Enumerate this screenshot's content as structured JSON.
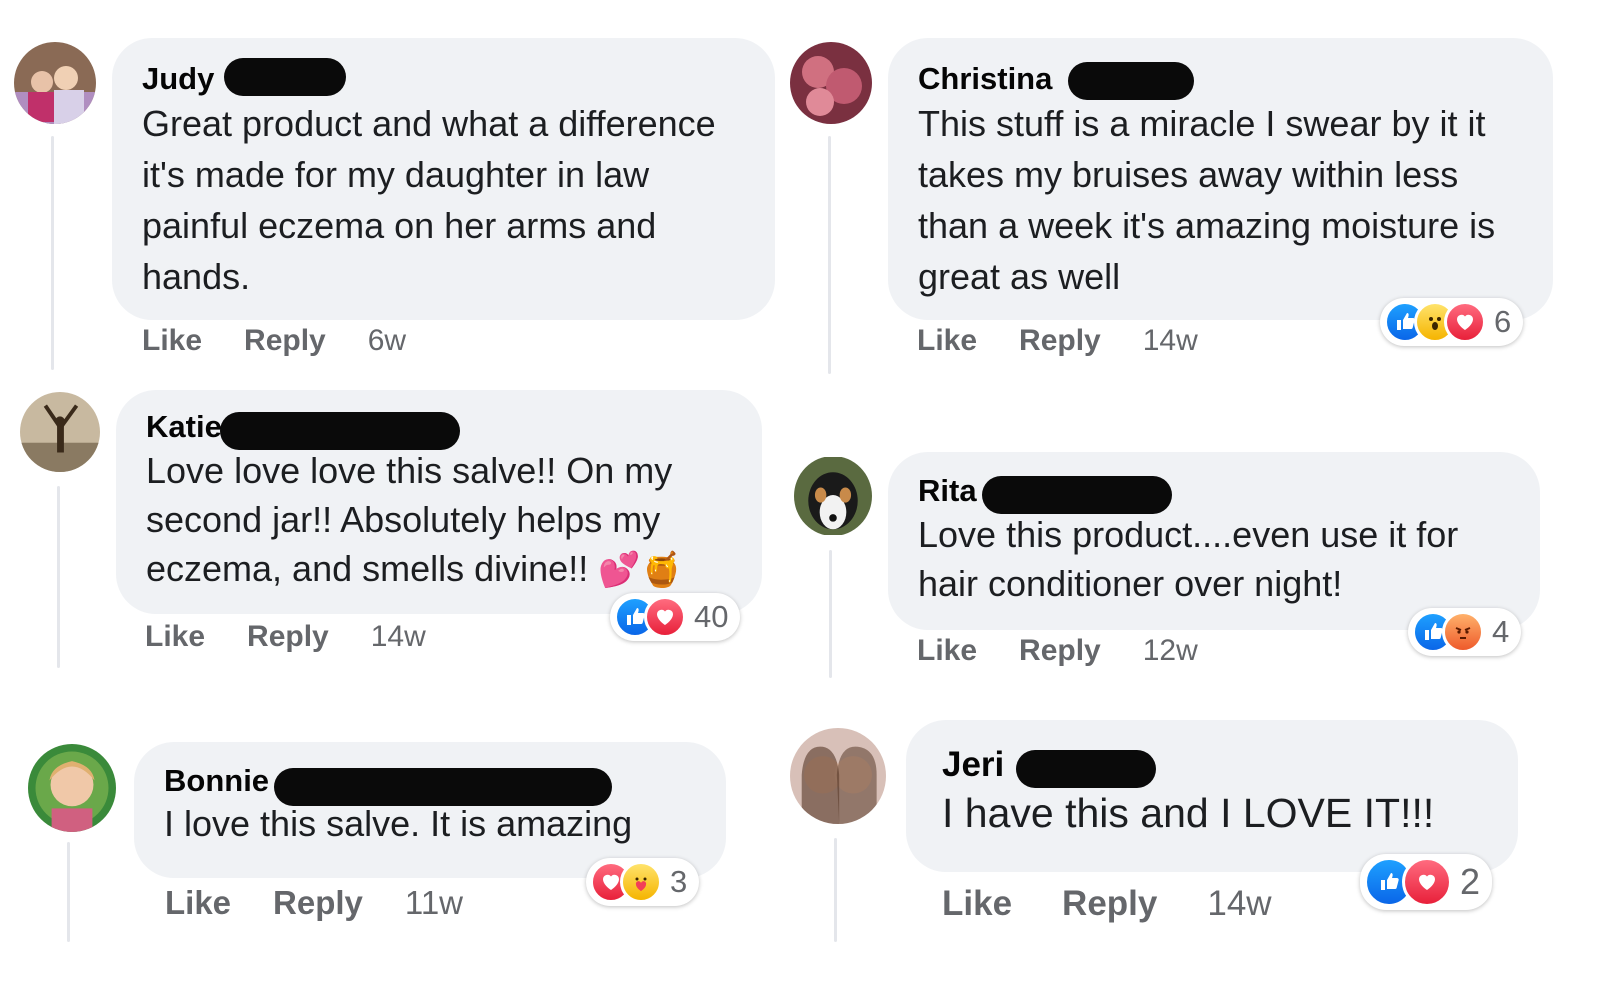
{
  "comments": [
    {
      "name": "Judy",
      "text": "Great product and what a difference it's made for my daughter in law painful eczema on her arms and hands.",
      "actions": {
        "like": "Like",
        "reply": "Reply",
        "time": "6w"
      },
      "reactions": null
    },
    {
      "name": "Christina",
      "text": "This stuff is a miracle I swear by it it takes my bruises away within less than a week it's amazing moisture is great as well",
      "actions": {
        "like": "Like",
        "reply": "Reply",
        "time": "14w"
      },
      "reactions": {
        "icons": [
          "like-icon",
          "wow-icon",
          "love-icon"
        ],
        "count": "6"
      }
    },
    {
      "name": "Katie",
      "text": "Love love love this salve!! On my second jar!! Absolutely helps my eczema, and smells divine!!",
      "emoji": "💕🍯",
      "actions": {
        "like": "Like",
        "reply": "Reply",
        "time": "14w"
      },
      "reactions": {
        "icons": [
          "like-icon",
          "love-icon"
        ],
        "count": "40"
      }
    },
    {
      "name": "Rita",
      "text": "Love this product....even use it for hair conditioner over night!",
      "actions": {
        "like": "Like",
        "reply": "Reply",
        "time": "12w"
      },
      "reactions": {
        "icons": [
          "like-icon",
          "angry-icon"
        ],
        "count": "4"
      }
    },
    {
      "name": "Bonnie",
      "text": "I love this salve. It is amazing",
      "actions": {
        "like": "Like",
        "reply": "Reply",
        "time": "11w"
      },
      "reactions": {
        "icons": [
          "love-icon",
          "care-icon"
        ],
        "count": "3"
      }
    },
    {
      "name": "Jeri",
      "text": "I have this and I LOVE IT!!!",
      "actions": {
        "like": "Like",
        "reply": "Reply",
        "time": "14w"
      },
      "reactions": {
        "icons": [
          "like-icon",
          "love-icon"
        ],
        "count": "2"
      }
    }
  ],
  "colors": {
    "bubble": "#f0f2f5",
    "meta": "#65676b",
    "like": "#1877f2",
    "love": "#f33e58"
  }
}
